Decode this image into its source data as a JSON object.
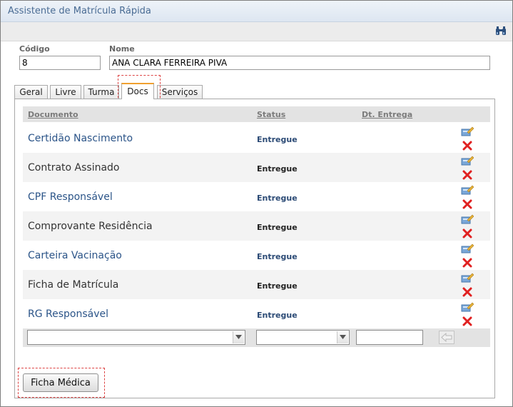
{
  "window": {
    "title": "Assistente de Matrícula Rápida"
  },
  "toolbar": {
    "icon": "binoculars-icon"
  },
  "form": {
    "codigo_label": "Código",
    "codigo_value": "8",
    "nome_label": "Nome",
    "nome_value": "ANA CLARA FERREIRA PIVA"
  },
  "tabs": [
    {
      "label": "Geral"
    },
    {
      "label": "Livre"
    },
    {
      "label": "Turma"
    },
    {
      "label": "Docs",
      "active": true
    },
    {
      "label": "Serviços"
    }
  ],
  "table": {
    "headers": {
      "documento": "Documento",
      "status": "Status",
      "dt_entrega": "Dt. Entrega"
    },
    "rows": [
      {
        "documento": "Certidão Nascimento",
        "status": "Entregue",
        "dt_entrega": ""
      },
      {
        "documento": "Contrato Assinado",
        "status": "Entregue",
        "dt_entrega": ""
      },
      {
        "documento": "CPF Responsável",
        "status": "Entregue",
        "dt_entrega": ""
      },
      {
        "documento": "Comprovante Residência",
        "status": "Entregue",
        "dt_entrega": ""
      },
      {
        "documento": "Carteira Vacinação",
        "status": "Entregue",
        "dt_entrega": ""
      },
      {
        "documento": "Ficha de Matrícula",
        "status": "Entregue",
        "dt_entrega": ""
      },
      {
        "documento": "RG Responsável",
        "status": "Entregue",
        "dt_entrega": ""
      }
    ],
    "add_row": {
      "documento_value": "",
      "status_value": "",
      "dt_entrega_value": ""
    }
  },
  "buttons": {
    "ficha_medica": "Ficha Médica"
  },
  "colors": {
    "link": "#2b5488",
    "highlight_dash": "#dd4444",
    "active_tab_accent": "#f0a030"
  }
}
